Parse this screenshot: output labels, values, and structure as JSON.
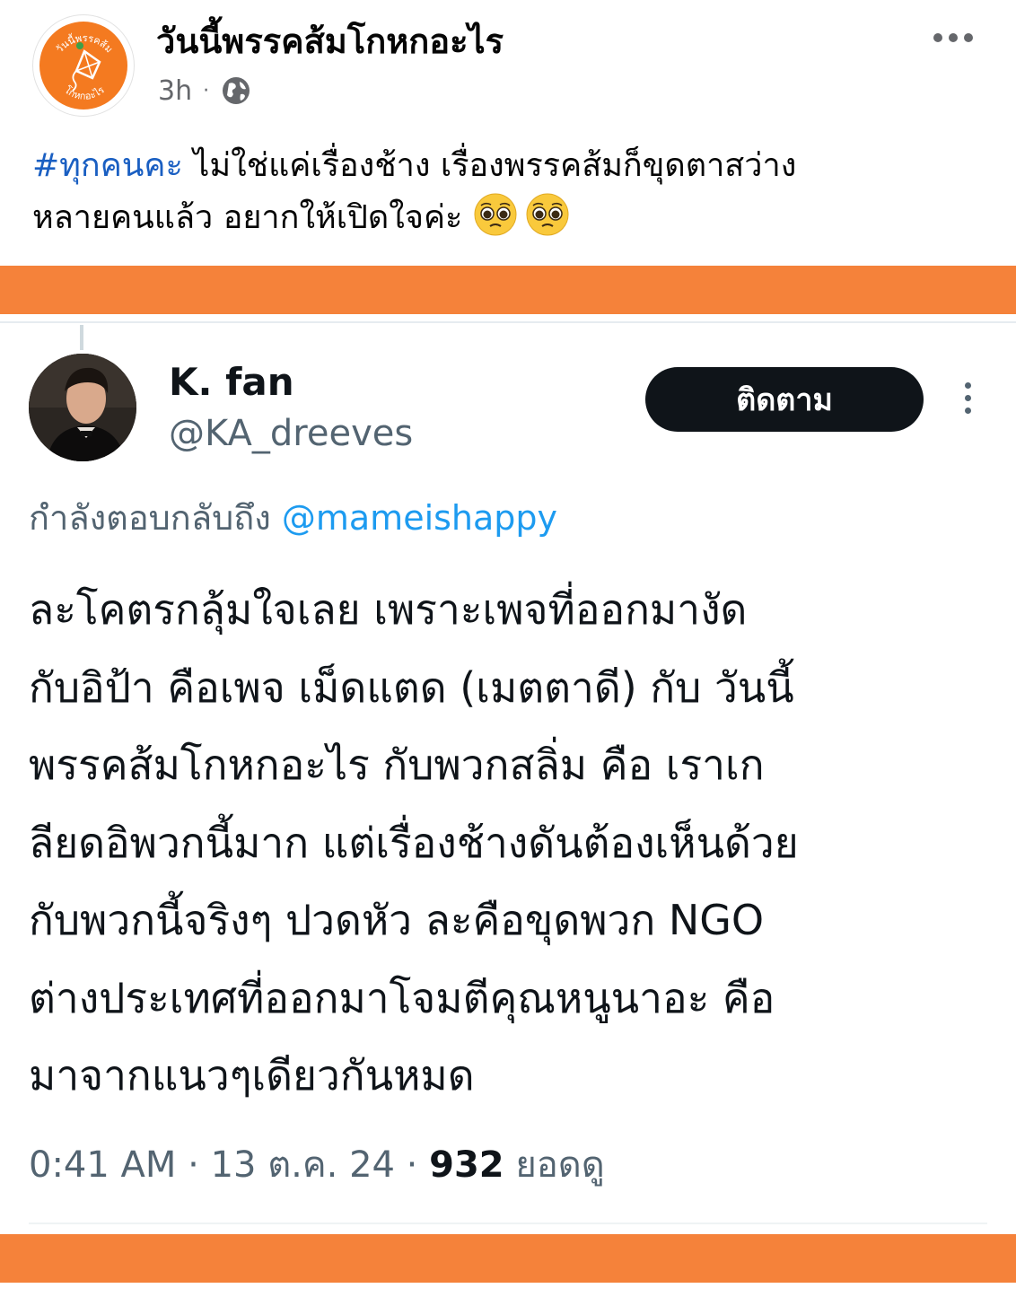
{
  "post": {
    "page_name": "วันนี้พรรคส้มโกหกอะไร",
    "avatar_text_top": "วันนี้พรรคส้ม",
    "avatar_text_bottom": "โกหกอะไร",
    "time": "3h",
    "separator": "·",
    "privacy_icon": "globe-icon",
    "hashtag": "#ทุกคนคะ",
    "text_line1": " ไม่ใช่แค่เรื่องช้าง เรื่องพรรคส้มก็ขุดตาสว่าง",
    "text_line2": "หลายคนแล้ว อยากให้เปิดใจค่ะ",
    "emojis": [
      "pleading-face-emoji",
      "pleading-face-emoji"
    ]
  },
  "tweet": {
    "display_name": "K. fan",
    "handle": "@KA_dreeves",
    "follow_label": "ติดตาม",
    "reply_prefix": "กำลังตอบกลับถึง ",
    "reply_mention": "@mameishappy",
    "body_lines": [
      "ละโคตรกลุ้มใจเลย เพราะเพจที่ออกมางัด",
      "กับอิป้า คือเพจ เม็ดแตด (เมตตาดี) กับ วันนี้",
      "พรรคส้มโกหกอะไร กับพวกสลิ่ม คือ เราเก",
      "ลียดอิพวกนี้มาก แต่เรื่องช้างดันต้องเห็นด้วย",
      "กับพวกนี้จริงๆ ปวดหัว ละคือขุดพวก NGO",
      "ต่างประเทศที่ออกมาโจมตีคุณหนูนาอะ คือ",
      "มาจากแนวๆเดียวกันหมด"
    ],
    "time": "0:41 AM",
    "date": "13 ต.ค. 24",
    "separator": " · ",
    "views_count": "932",
    "views_label": "ยอดดู"
  },
  "colors": {
    "accent_orange": "#f5823a",
    "hashtag_blue": "#1a5fc2",
    "mention_blue": "#1d9bf0",
    "follow_button": "#0f1419"
  }
}
